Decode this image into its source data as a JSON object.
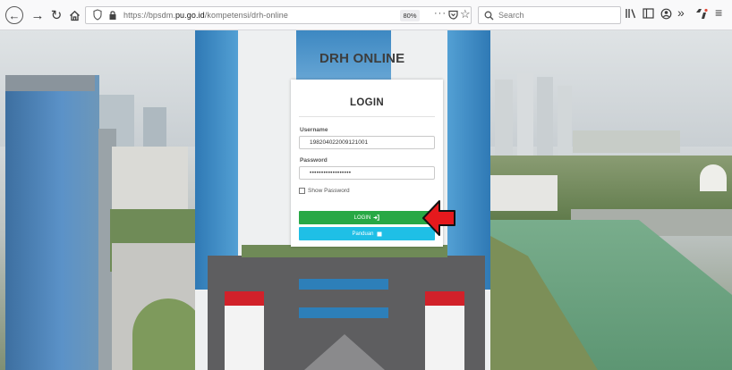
{
  "browser": {
    "url_prefix": "https://bpsdm.",
    "url_domain": "pu.go.id",
    "url_suffix": "/kompetensi/drh-online",
    "zoom": "80%",
    "overflow_menu": "···",
    "search_placeholder": "Search"
  },
  "page": {
    "brand": "DRH ONLINE",
    "login": {
      "title": "LOGIN",
      "username_label": "Username",
      "username_value": "198204022009121001",
      "password_label": "Password",
      "password_value": "••••••••••••••••••",
      "show_password_label": "Show Password",
      "login_button": "LOGIN",
      "guide_button": "Panduan"
    }
  },
  "colors": {
    "login_button": "#28a845",
    "guide_button": "#1fbfe6",
    "annotation_arrow": "#e5191d"
  }
}
